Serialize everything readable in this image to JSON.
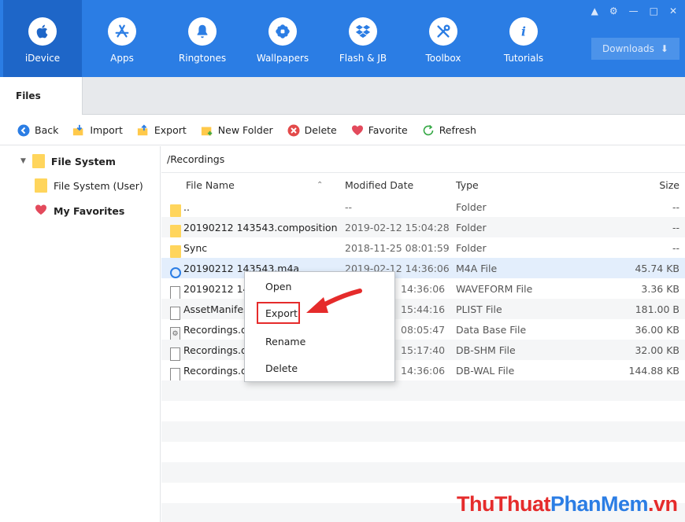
{
  "nav": {
    "items": [
      {
        "label": "iDevice",
        "icon": "apple-icon"
      },
      {
        "label": "Apps",
        "icon": "app-store-icon"
      },
      {
        "label": "Ringtones",
        "icon": "bell-icon"
      },
      {
        "label": "Wallpapers",
        "icon": "flower-icon"
      },
      {
        "label": "Flash & JB",
        "icon": "dropbox-icon"
      },
      {
        "label": "Toolbox",
        "icon": "tools-icon"
      },
      {
        "label": "Tutorials",
        "icon": "info-icon"
      }
    ],
    "active": "iDevice",
    "downloads_label": "Downloads"
  },
  "tabs": {
    "files": "Files"
  },
  "toolbar": {
    "back": "Back",
    "import": "Import",
    "export": "Export",
    "new_folder": "New Folder",
    "delete": "Delete",
    "favorite": "Favorite",
    "refresh": "Refresh"
  },
  "sidebar": {
    "file_system": "File System",
    "file_system_user": "File System (User)",
    "my_favorites": "My Favorites"
  },
  "main": {
    "path": "/Recordings",
    "columns": {
      "name": "File Name",
      "date": "Modified Date",
      "type": "Type",
      "size": "Size"
    },
    "rows": [
      {
        "name": "..",
        "date": "--",
        "type": "Folder",
        "size": "--"
      },
      {
        "name": "20190212 143543.composition",
        "date": "2019-02-12 15:04:28",
        "type": "Folder",
        "size": "--"
      },
      {
        "name": "Sync",
        "date": "2018-11-25 08:01:59",
        "type": "Folder",
        "size": "--"
      },
      {
        "name": "20190212 143543.m4a",
        "date": "2019-02-12 14:36:06",
        "type": "M4A File",
        "size": "45.74 KB"
      },
      {
        "name": "20190212 143",
        "date": "14:36:06",
        "type": "WAVEFORM File",
        "size": "3.36 KB"
      },
      {
        "name": "AssetManifes",
        "date": "15:44:16",
        "type": "PLIST File",
        "size": "181.00 B"
      },
      {
        "name": "Recordings.d",
        "date": "08:05:47",
        "type": "Data Base File",
        "size": "36.00 KB"
      },
      {
        "name": "Recordings.d",
        "date": "15:17:40",
        "type": "DB-SHM File",
        "size": "32.00 KB"
      },
      {
        "name": "Recordings.d",
        "date": "14:36:06",
        "type": "DB-WAL File",
        "size": "144.88 KB"
      }
    ]
  },
  "context_menu": {
    "open": "Open",
    "export": "Export",
    "rename": "Rename",
    "delete": "Delete"
  },
  "watermark": {
    "part1": "ThuThuat",
    "part2": "PhanMem",
    "part3": ".vn"
  },
  "colors": {
    "accent": "#2b7de4",
    "highlight": "#e52b2b"
  }
}
